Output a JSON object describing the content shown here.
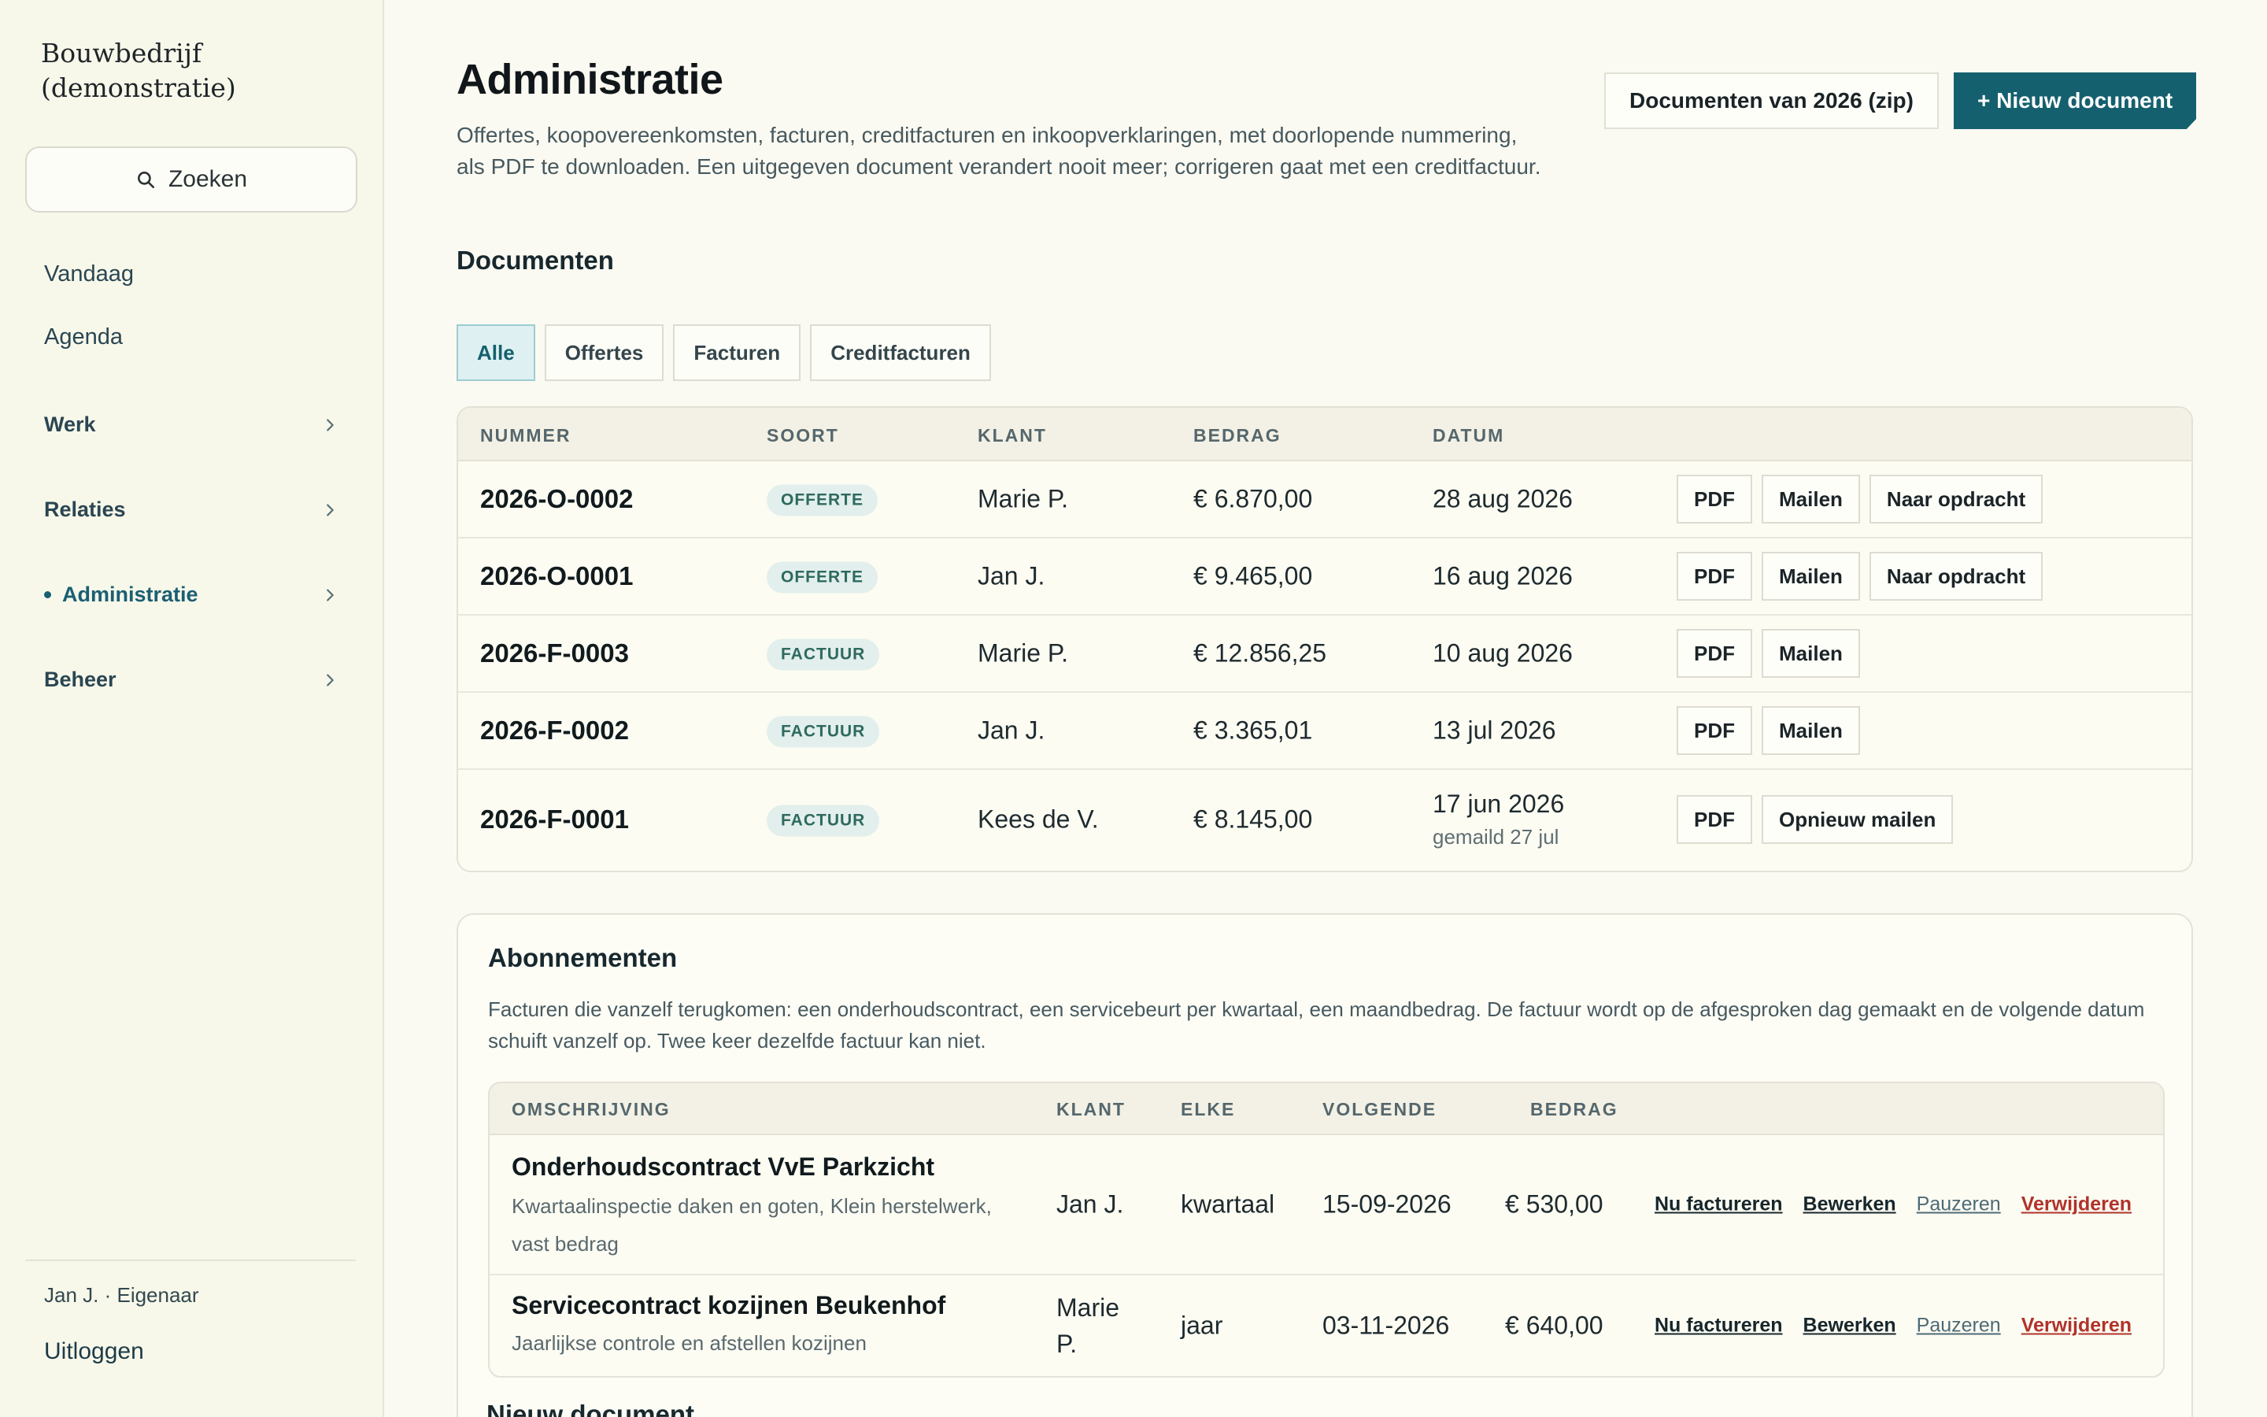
{
  "sidebar": {
    "brand_line1": "Bouwbedrijf",
    "brand_line2": "(demonstratie)",
    "search_label": "Zoeken",
    "items": [
      {
        "label": "Vandaag"
      },
      {
        "label": "Agenda"
      },
      {
        "label": "Werk"
      },
      {
        "label": "Relaties"
      },
      {
        "label": "Administratie"
      },
      {
        "label": "Beheer"
      }
    ],
    "user": "Jan J. · Eigenaar",
    "logout": "Uitloggen"
  },
  "header": {
    "title": "Administratie",
    "description": "Offertes, koopovereenkomsten, facturen, creditfacturen en inkoopverklaringen, met doorlopende nummering, als PDF te downloaden. Een uitgegeven document verandert nooit meer; corrigeren gaat met een creditfactuur.",
    "zip_button": "Documenten van 2026 (zip)",
    "new_button": "+ Nieuw document"
  },
  "documents": {
    "title": "Documenten",
    "filters": [
      "Alle",
      "Offertes",
      "Facturen",
      "Creditfacturen"
    ],
    "columns": [
      "NUMMER",
      "SOORT",
      "KLANT",
      "BEDRAG",
      "DATUM"
    ],
    "rows": [
      {
        "number": "2026-O-0002",
        "type": "OFFERTE",
        "client": "Marie P.",
        "amount": "€ 6.870,00",
        "date": "28 aug 2026",
        "sub": "",
        "actions": [
          "PDF",
          "Mailen",
          "Naar opdracht"
        ]
      },
      {
        "number": "2026-O-0001",
        "type": "OFFERTE",
        "client": "Jan J.",
        "amount": "€ 9.465,00",
        "date": "16 aug 2026",
        "sub": "",
        "actions": [
          "PDF",
          "Mailen",
          "Naar opdracht"
        ]
      },
      {
        "number": "2026-F-0003",
        "type": "FACTUUR",
        "client": "Marie P.",
        "amount": "€ 12.856,25",
        "date": "10 aug 2026",
        "sub": "",
        "actions": [
          "PDF",
          "Mailen"
        ]
      },
      {
        "number": "2026-F-0002",
        "type": "FACTUUR",
        "client": "Jan J.",
        "amount": "€ 3.365,01",
        "date": "13 jul 2026",
        "sub": "",
        "actions": [
          "PDF",
          "Mailen"
        ]
      },
      {
        "number": "2026-F-0001",
        "type": "FACTUUR",
        "client": "Kees de V.",
        "amount": "€ 8.145,00",
        "date": "17 jun 2026",
        "sub": "gemaild 27 jul",
        "actions": [
          "PDF",
          "Opnieuw mailen"
        ]
      }
    ]
  },
  "subscriptions": {
    "title": "Abonnementen",
    "description": "Facturen die vanzelf terugkomen: een onderhoudscontract, een servicebeurt per kwartaal, een maandbedrag. De factuur wordt op de afgesproken dag gemaakt en de volgende datum schuift vanzelf op. Twee keer dezelfde factuur kan niet.",
    "columns": [
      "OMSCHRIJVING",
      "KLANT",
      "ELKE",
      "VOLGENDE",
      "BEDRAG"
    ],
    "rows": [
      {
        "name": "Onderhoudscontract VvE Parkzicht",
        "note": "Kwartaalinspectie daken en goten, Klein herstelwerk, vast bedrag",
        "client": "Jan J.",
        "every": "kwartaal",
        "next": "15-09-2026",
        "amount": "€ 530,00"
      },
      {
        "name": "Servicecontract kozijnen Beukenhof",
        "note": "Jaarlijkse controle en afstellen kozijnen",
        "client": "Marie P.",
        "every": "jaar",
        "next": "03-11-2026",
        "amount": "€ 640,00"
      }
    ],
    "actions": {
      "invoice": "Nu factureren",
      "edit": "Bewerken",
      "pause": "Pauzeren",
      "delete": "Verwijderen"
    }
  },
  "next_section_title": "Nieuw document"
}
